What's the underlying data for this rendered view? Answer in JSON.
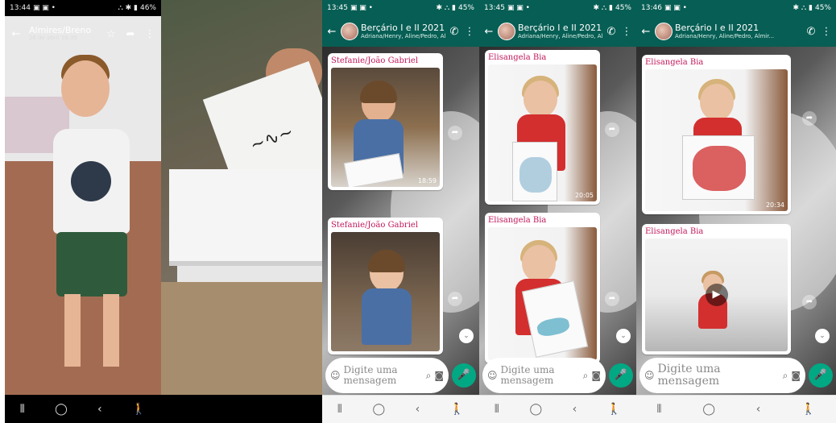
{
  "viewer": {
    "status_time": "13:44",
    "status_right": "46%",
    "contact_name": "Almires/Breno",
    "date": "26 de abril 16:39",
    "icons": [
      "back-arrow-icon",
      "star-icon",
      "share-icon",
      "more-icon"
    ]
  },
  "chats": [
    {
      "status_time": "13:45",
      "status_right": "45%",
      "group_name": "Berçário I e II 2021",
      "members": "Adriana/Henry, Aline/Pedro, Almir...",
      "messages": [
        {
          "sender": "Stefanie/João Gabriel",
          "time": "18:59"
        },
        {
          "sender": "Stefanie/João Gabriel",
          "time": ""
        }
      ],
      "input_placeholder": "Digite uma mensagem"
    },
    {
      "status_time": "13:45",
      "status_right": "45%",
      "group_name": "Berçário I e II 2021",
      "members": "Adriana/Henry, Aline/Pedro, Almir...",
      "messages": [
        {
          "sender": "Elisangela Bia",
          "time": "20:05"
        },
        {
          "sender": "Elisangela Bia",
          "time": ""
        }
      ],
      "input_placeholder": "Digite uma mensagem"
    },
    {
      "status_time": "13:46",
      "status_right": "45%",
      "group_name": "Berçário I e II 2021",
      "members": "Adriana/Henry, Aline/Pedro, Almir...",
      "messages": [
        {
          "sender": "Elisangela Bia",
          "time": "20:34"
        },
        {
          "sender": "Elisangela Bia",
          "time": ""
        }
      ],
      "input_placeholder": "Digite uma mensagem"
    }
  ],
  "colors": {
    "whatsapp_header": "#075e54",
    "sender_name": "#c2185b",
    "mic_button": "#00a884"
  }
}
